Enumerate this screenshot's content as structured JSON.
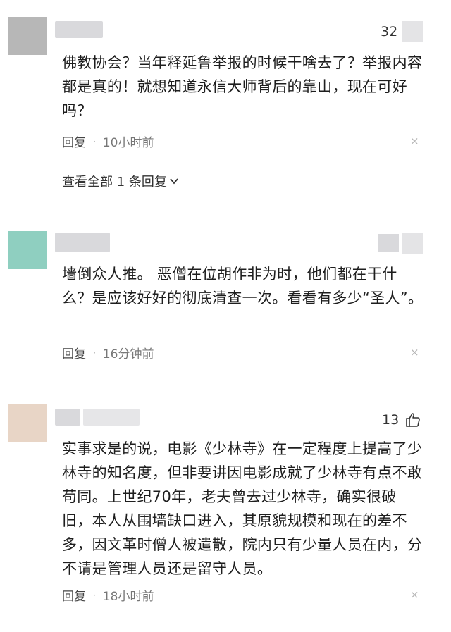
{
  "colors": {
    "avatar_1": "#b7b7b7",
    "avatar_2": "#8fcfc0",
    "avatar_3": "#e8d5c6",
    "text": "#1e1e1e",
    "meta": "#666666"
  },
  "comments": [
    {
      "like_count": "32",
      "text": "佛教协会？当年释延鲁举报的时候干啥去了？举报内容都是真的！就想知道永信大师背后的靠山，现在可好吗？",
      "reply_label": "回复",
      "separator": "·",
      "time": "10小时前",
      "close_glyph": "×",
      "view_all": "查看全部 1 条回复"
    },
    {
      "like_count": "",
      "text": "墙倒众人推。 恶僧在位胡作非为时，他们都在干什么？是应该好好的彻底清查一次。看看有多少“圣人”。",
      "reply_label": "回复",
      "separator": "·",
      "time": "16分钟前",
      "close_glyph": "×"
    },
    {
      "like_count": "13",
      "like_icon": "thumbs-up-icon",
      "text": "实事求是的说，电影《少林寺》在一定程度上提高了少林寺的知名度，但非要讲因电影成就了少林寺有点不敢苟同。上世纪70年，老夫曾去过少林寺，确实很破旧，本人从围墙缺口进入，其原貌规模和现在的差不多，因文革时僧人被遣散，院内只有少量人员在内，分不请是管理人员还是留守人员。",
      "reply_label": "回复",
      "separator": "·",
      "time": "18小时前",
      "close_glyph": "×"
    }
  ]
}
